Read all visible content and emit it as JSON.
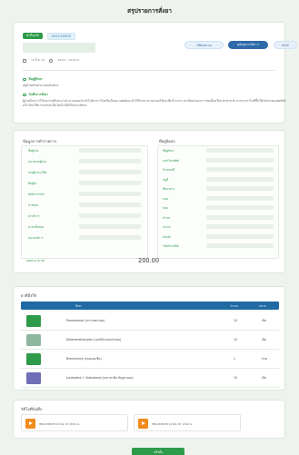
{
  "page": {
    "title": "สรุปรายการสั่งยา"
  },
  "header": {
    "status_badge": "สำเร็จแล้ว",
    "order_id": "HN12345678",
    "date": "14 มี.ค. 67",
    "time": "09:00 - 10:00 น.",
    "buttons": {
      "status": "เปลี่ยนสถานะ",
      "order": "ดูข้อมูลการสั่งยา ▾",
      "cancel": "ยกเลิก"
    },
    "address_label": "ที่อยู่ผู้รับยา",
    "address_text": "หมู่บ้านตัวอย่าง ถนนตัวอย่าง",
    "note_label": "บันทึกการสั่งยา",
    "note_text": "ผู้ป่วยมีอาการไข้และปวดศีรษะมาประมาณสองวัน ยังไม่มีอาการไอหรือเจ็บคอ แพทย์แนะนำให้รับประทานยาลดไข้และดื่มน้ำมากๆ ควรติดตามอาการต่อเนื่องเป็นเวลาสามวัน หากอาการไม่ดีขึ้นให้กลับมาพบแพทย์อีกครั้ง ห้ามใช้ยาร่วมกับยาอื่นโดยไม่ได้ปรึกษาเภสัชกร"
  },
  "details": {
    "left_title": "ข้อมูลการทำรายการ",
    "left_fields": [
      "ชื่อผู้ป่วย",
      "หมายเลขผู้ป่วย",
      "เลขผู้ป่วย (HN)",
      "ชื่อผู้รับ",
      "สิทธิการรักษา",
      "ค่าจัดส่ง",
      "ค่าบริการ",
      "ค่ายาทั้งหมด",
      "หน่วยบริการ"
    ],
    "right_title": "ที่อยู่จัดส่ง",
    "right_fields": [
      "ชื่อผู้รับยา",
      "เบอร์โทรศัพท์",
      "บ้านเลขที่",
      "หมู่ที่",
      "ชื่ออาคาร",
      "ถนน",
      "ซอย",
      "ตำบล",
      "อำเภอ",
      "จังหวัด",
      "รหัสไปรษณีย์"
    ],
    "total_label": "ยอดรวม (บาท)",
    "total_value": "200.00"
  },
  "medicines": {
    "title": "ยาที่สั่งใช้",
    "headers": {
      "name": "ชื่อยา",
      "qty": "จำนวน",
      "unit": "หน่วย"
    },
    "rows": [
      {
        "name": "Paracetamol (พาราเซตามอล)",
        "qty": "10",
        "unit": "เม็ด",
        "thumb_color": "#2e9b4a"
      },
      {
        "name": "Dextromethorphan (เดกซ์โทรเมทอร์แฟน)",
        "qty": "10",
        "unit": "เม็ด",
        "thumb_color": "#8fb7a0"
      },
      {
        "name": "Bromhexine (บรอมเฮกซีน)",
        "qty": "1",
        "unit": "ขวด",
        "thumb_color": "#2e9b4a"
      },
      {
        "name": "Loratadine + Salbutamol (ลอราทาดีน ซัลบูทามอล)",
        "qty": "10",
        "unit": "เม็ด",
        "thumb_color": "#6f6fb8"
      }
    ]
  },
  "videos": {
    "title": "วิดีโอที่บันทึก",
    "items": [
      "HN12345678 13 มี.ค. 67 09:54 น.",
      "HN12345678 13 มี.ค. 67 10:20 น."
    ]
  },
  "bottom": {
    "button_label": "เสร็จสิ้น"
  }
}
